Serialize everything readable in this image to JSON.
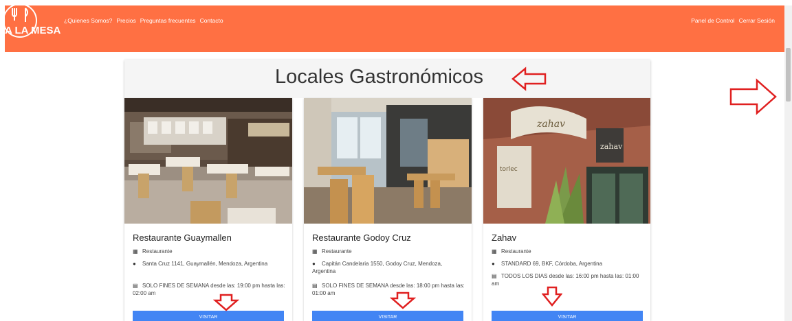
{
  "navbar": {
    "logo_text": "A LA MESA",
    "links": [
      "¿Quienes Somos?",
      "Precios",
      "Preguntas frecuentes",
      "Contacto"
    ],
    "right_links": [
      "Panel de Control",
      "Cerrar Sesión"
    ],
    "background": "#ff7043"
  },
  "main": {
    "title": "Locales Gastronómicos"
  },
  "cards": [
    {
      "name": "Restaurante Guaymallen",
      "type": "Restaurante",
      "address": "Santa Cruz 1141, Guaymallén, Mendoza, Argentina",
      "schedule": "SOLO FINES DE SEMANA desde las: 19:00 pm hasta las: 02:00 am",
      "button": "VISITAR"
    },
    {
      "name": "Restaurante Godoy Cruz",
      "type": "Restaurante",
      "address": "Capitán Candelaria 1550, Godoy Cruz, Mendoza, Argentina",
      "schedule": "SOLO FINES DE SEMANA desde las: 18:00 pm hasta las: 01:00 am",
      "button": "VISITAR"
    },
    {
      "name": "Zahav",
      "type": "Restaurante",
      "address": "STANDARD 69, BKF, Córdoba, Argentina",
      "schedule": "TODOS LOS DIAS desde las: 16:00 pm hasta las: 01:00 am",
      "button": "VISITAR"
    }
  ],
  "icons": {
    "type": "building-icon",
    "address": "globe-icon",
    "schedule": "calendar-icon"
  },
  "colors": {
    "accent": "#ff7043",
    "button": "#4285f4",
    "annotation": "#e02020"
  }
}
